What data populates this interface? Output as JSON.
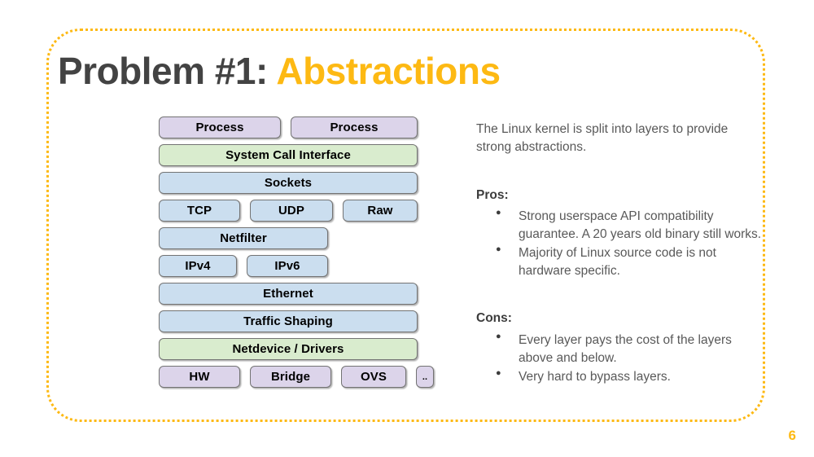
{
  "slide": {
    "title_main": "Problem #1:",
    "title_accent": "Abstractions",
    "page_number": "6",
    "accent_color": "#FDB913",
    "title_color": "#434343"
  },
  "diagram": {
    "name": "linux-kernel-network-stack",
    "colors": {
      "userspace": "#DCD4EA",
      "interface": "#D9ECCE",
      "network": "#CBDEEF",
      "border": "#737373"
    },
    "rows": [
      {
        "id": "process-row",
        "boxes": [
          {
            "label": "Process",
            "color": "purple",
            "flex": 150
          },
          {
            "label": "Process",
            "color": "purple",
            "flex": 156
          }
        ]
      },
      {
        "id": "syscall-row",
        "boxes": [
          {
            "label": "System Call Interface",
            "color": "green",
            "flex": 318
          }
        ]
      },
      {
        "id": "sockets-row",
        "boxes": [
          {
            "label": "Sockets",
            "color": "blue",
            "flex": 318
          }
        ]
      },
      {
        "id": "transport-row",
        "boxes": [
          {
            "label": "TCP",
            "color": "blue",
            "flex": 100
          },
          {
            "label": "UDP",
            "color": "blue",
            "flex": 102
          },
          {
            "label": "Raw",
            "color": "blue",
            "flex": 92
          }
        ]
      },
      {
        "id": "netfilter-row",
        "boxes": [
          {
            "label": "Netfilter",
            "color": "blue",
            "flex": 208
          }
        ]
      },
      {
        "id": "ip-row",
        "boxes": [
          {
            "label": "IPv4",
            "color": "blue",
            "flex": 96
          },
          {
            "label": "IPv6",
            "color": "blue",
            "flex": 100
          }
        ]
      },
      {
        "id": "ethernet-row",
        "boxes": [
          {
            "label": "Ethernet",
            "color": "blue",
            "flex": 318
          }
        ]
      },
      {
        "id": "traffic-shaping-row",
        "boxes": [
          {
            "label": "Traffic Shaping",
            "color": "blue",
            "flex": 318
          }
        ]
      },
      {
        "id": "netdevice-row",
        "boxes": [
          {
            "label": "Netdevice / Drivers",
            "color": "green",
            "flex": 318
          }
        ]
      },
      {
        "id": "device-row",
        "boxes": [
          {
            "label": "HW",
            "color": "purple",
            "flex": 100
          },
          {
            "label": "Bridge",
            "color": "purple",
            "flex": 100
          },
          {
            "label": "OVS",
            "color": "purple",
            "flex": 80
          },
          {
            "label": "..",
            "color": "purple",
            "flex": 22,
            "tiny": true
          }
        ]
      }
    ]
  },
  "copy": {
    "intro": "The Linux kernel is split into layers to provide strong abstractions.",
    "pros_heading": "Pros:",
    "pros": [
      "Strong userspace API compatibility guarantee. A 20 years old binary still works.",
      "Majority of Linux source code is not hardware specific."
    ],
    "cons_heading": "Cons:",
    "cons": [
      "Every layer pays the cost of the layers above and below.",
      "Very hard to bypass layers."
    ]
  }
}
